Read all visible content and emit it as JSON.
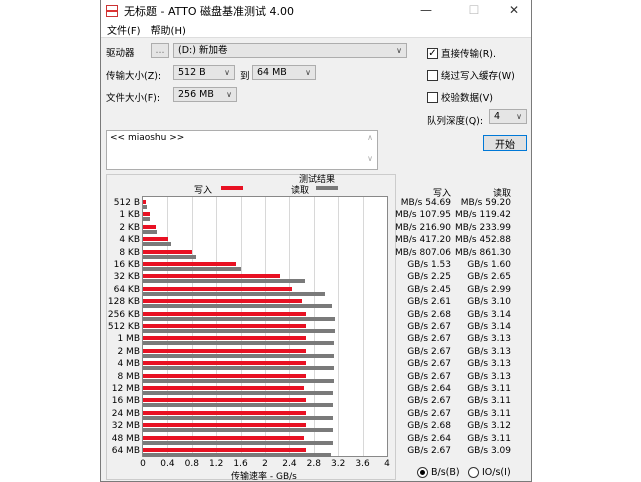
{
  "window": {
    "title": "无标题 - ATTO 磁盘基准测试 4.00",
    "minimize": "—",
    "maximize": "☐",
    "close": "✕"
  },
  "menu": [
    "文件(F)",
    "帮助(H)"
  ],
  "form": {
    "drive_label": "驱动器",
    "browse": "...",
    "drive_value": "(D:) 新加卷",
    "transfer_label": "传输大小(Z):",
    "transfer_from": "512 B",
    "to_label": "到",
    "transfer_to": "64 MB",
    "file_label": "文件大小(F):",
    "file_value": "256 MB",
    "direct_io": "直接传输(R).",
    "direct_io_checked": true,
    "bypass_cache": "绕过写入缓存(W)",
    "bypass_checked": false,
    "verify": "校验数据(V)",
    "verify_checked": false,
    "queue_label": "队列深度(Q):",
    "queue_value": "4",
    "start": "开始",
    "description": "<< miaoshu >>"
  },
  "results": {
    "title": "测试结果",
    "write_header": "写入",
    "read_header": "读取",
    "units_bs": "B/s(B)",
    "units_io": "IO/s(I)",
    "units_selected": "B/s"
  },
  "chart_data": {
    "type": "bar",
    "orientation": "horizontal",
    "title": "测试结果",
    "xlabel": "传输速率 - GB/s",
    "xlim": [
      0,
      4
    ],
    "xticks": [
      "0",
      "0.4",
      "0.8",
      "1.2",
      "1.6",
      "2",
      "2.4",
      "2.8",
      "3.2",
      "3.6",
      "4"
    ],
    "categories": [
      "512 B",
      "1 KB",
      "2 KB",
      "4 KB",
      "8 KB",
      "16 KB",
      "32 KB",
      "64 KB",
      "128 KB",
      "256 KB",
      "512 KB",
      "1 MB",
      "2 MB",
      "4 MB",
      "8 MB",
      "12 MB",
      "16 MB",
      "24 MB",
      "32 MB",
      "48 MB",
      "64 MB"
    ],
    "series": [
      {
        "name": "写入",
        "color": "#e81123",
        "values": [
          0.0547,
          0.108,
          0.217,
          0.417,
          0.807,
          1.53,
          2.25,
          2.45,
          2.61,
          2.68,
          2.67,
          2.67,
          2.67,
          2.67,
          2.67,
          2.64,
          2.67,
          2.67,
          2.68,
          2.64,
          2.67
        ],
        "labels": [
          "54.69 MB/s",
          "107.95 MB/s",
          "216.90 MB/s",
          "417.20 MB/s",
          "807.06 MB/s",
          "1.53 GB/s",
          "2.25 GB/s",
          "2.45 GB/s",
          "2.61 GB/s",
          "2.68 GB/s",
          "2.67 GB/s",
          "2.67 GB/s",
          "2.67 GB/s",
          "2.67 GB/s",
          "2.67 GB/s",
          "2.64 GB/s",
          "2.67 GB/s",
          "2.67 GB/s",
          "2.68 GB/s",
          "2.64 GB/s",
          "2.67 GB/s"
        ]
      },
      {
        "name": "读取",
        "color": "#7a7a7a",
        "values": [
          0.0592,
          0.119,
          0.234,
          0.453,
          0.861,
          1.6,
          2.65,
          2.99,
          3.1,
          3.14,
          3.14,
          3.13,
          3.13,
          3.13,
          3.13,
          3.11,
          3.11,
          3.11,
          3.12,
          3.11,
          3.09
        ],
        "labels": [
          "59.20 MB/s",
          "119.42 MB/s",
          "233.99 MB/s",
          "452.88 MB/s",
          "861.30 MB/s",
          "1.60 GB/s",
          "2.65 GB/s",
          "2.99 GB/s",
          "3.10 GB/s",
          "3.14 GB/s",
          "3.14 GB/s",
          "3.13 GB/s",
          "3.13 GB/s",
          "3.13 GB/s",
          "3.13 GB/s",
          "3.11 GB/s",
          "3.11 GB/s",
          "3.11 GB/s",
          "3.12 GB/s",
          "3.11 GB/s",
          "3.09 GB/s"
        ]
      }
    ]
  }
}
